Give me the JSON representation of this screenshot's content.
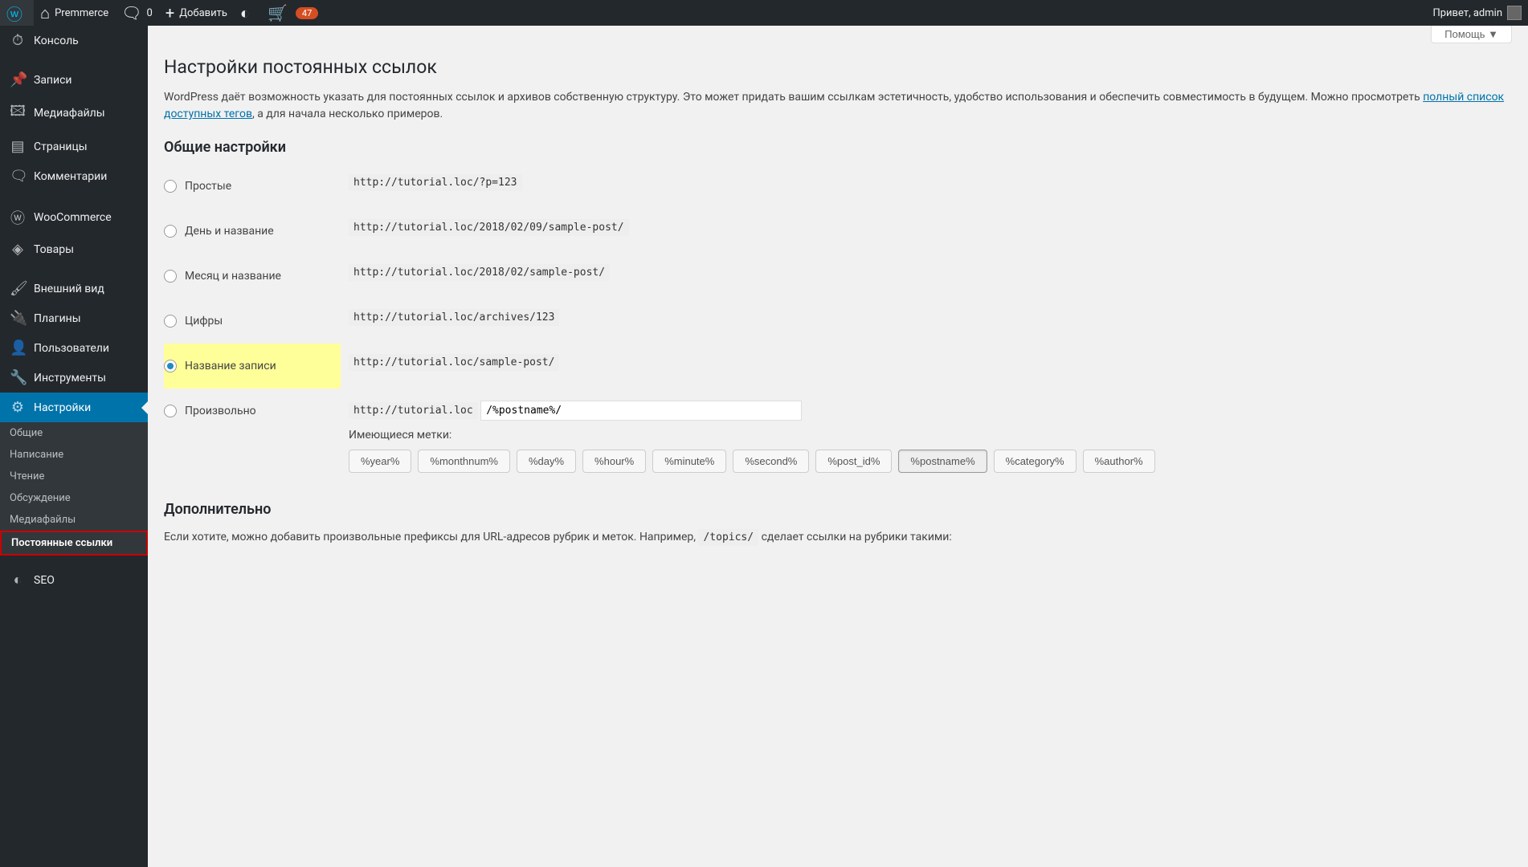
{
  "adminbar": {
    "site_name": "Premmerce",
    "comments_count": "0",
    "add_new": "Добавить",
    "notif_badge": "47",
    "greeting": "Привет, admin"
  },
  "sidemenu": {
    "console": "Консоль",
    "posts": "Записи",
    "media": "Медиафайлы",
    "pages": "Страницы",
    "comments": "Комментарии",
    "woocommerce": "WooCommerce",
    "products": "Товары",
    "appearance": "Внешний вид",
    "plugins": "Плагины",
    "users": "Пользователи",
    "tools": "Инструменты",
    "settings": "Настройки",
    "seo": "SEO"
  },
  "submenu": {
    "general": "Общие",
    "writing": "Написание",
    "reading": "Чтение",
    "discussion": "Обсуждение",
    "media": "Медиафайлы",
    "permalinks": "Постоянные ссылки"
  },
  "help_button": "Помощь ▼",
  "page_title": "Настройки постоянных ссылок",
  "intro_pre": "WordPress даёт возможность указать для постоянных ссылок и архивов собственную структуру. Это может придать вашим ссылкам эстетичность, удобство использования и обеспечить совместимость в будущем. Можно просмотреть ",
  "intro_link": "полный список доступных тегов",
  "intro_post": ", а для начала несколько примеров.",
  "common_heading": "Общие настройки",
  "options": {
    "plain": {
      "label": "Простые",
      "sample": "http://tutorial.loc/?p=123"
    },
    "dayname": {
      "label": "День и название",
      "sample": "http://tutorial.loc/2018/02/09/sample-post/"
    },
    "monthname": {
      "label": "Месяц и название",
      "sample": "http://tutorial.loc/2018/02/sample-post/"
    },
    "numeric": {
      "label": "Цифры",
      "sample": "http://tutorial.loc/archives/123"
    },
    "postname": {
      "label": "Название записи",
      "sample": "http://tutorial.loc/sample-post/"
    },
    "custom": {
      "label": "Произвольно",
      "base": "http://tutorial.loc",
      "value": "/%postname%/"
    }
  },
  "tags_label": "Имеющиеся метки:",
  "tags": [
    "%year%",
    "%monthnum%",
    "%day%",
    "%hour%",
    "%minute%",
    "%second%",
    "%post_id%",
    "%postname%",
    "%category%",
    "%author%"
  ],
  "tag_active": "%postname%",
  "optional_heading": "Дополнительно",
  "optional_text_pre": "Если хотите, можно добавить произвольные префиксы для URL-адресов рубрик и меток. Например, ",
  "optional_code": "/topics/",
  "optional_text_post": " сделает ссылки на рубрики такими:"
}
